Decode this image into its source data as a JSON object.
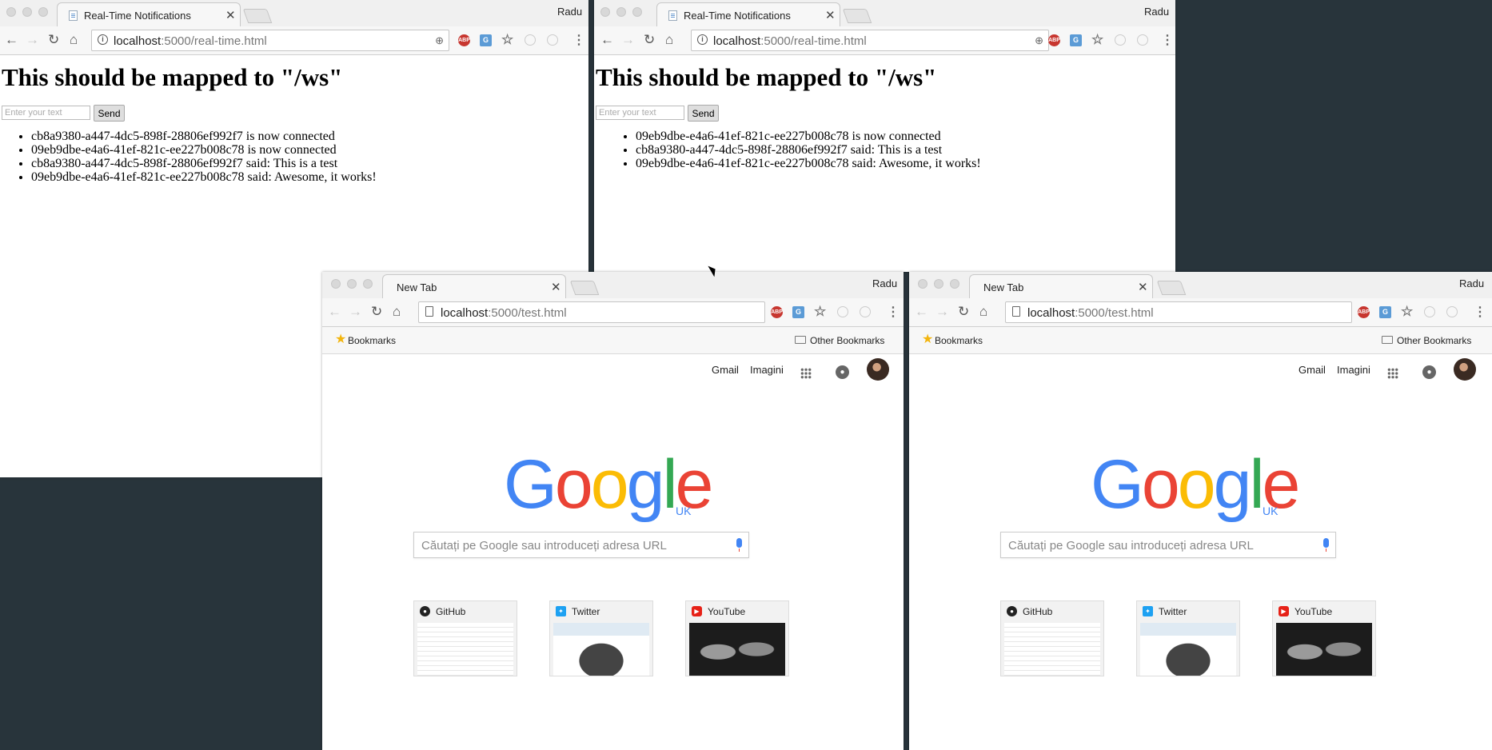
{
  "realtime": {
    "tab_title": "Real-Time Notifications",
    "profile": "Radu",
    "url_host": "localhost",
    "url_path": ":5000/real-time.html",
    "heading": "This should be mapped to \"/ws\"",
    "input_placeholder": "Enter your text",
    "send_label": "Send"
  },
  "window_left": {
    "messages": [
      "cb8a9380-a447-4dc5-898f-28806ef992f7 is now connected",
      "09eb9dbe-e4a6-41ef-821c-ee227b008c78 is now connected",
      "cb8a9380-a447-4dc5-898f-28806ef992f7 said: This is a test",
      "09eb9dbe-e4a6-41ef-821c-ee227b008c78 said: Awesome, it works!"
    ]
  },
  "window_right": {
    "messages": [
      "09eb9dbe-e4a6-41ef-821c-ee227b008c78 is now connected",
      "cb8a9380-a447-4dc5-898f-28806ef992f7 said: This is a test",
      "09eb9dbe-e4a6-41ef-821c-ee227b008c78 said: Awesome, it works!"
    ]
  },
  "newtab": {
    "tab_title": "New Tab",
    "profile": "Radu",
    "url_host": "localhost",
    "url_path": ":5000/test.html",
    "bookmarks_label": "Bookmarks",
    "other_bookmarks_label": "Other Bookmarks",
    "gmail": "Gmail",
    "images": "Imagini",
    "logo_letters": [
      "G",
      "o",
      "o",
      "g",
      "l",
      "e"
    ],
    "logo_region": "UK",
    "search_placeholder": "Căutați pe Google sau introduceți adresa URL",
    "tiles": [
      {
        "label": "GitHub",
        "icon": "github-icon"
      },
      {
        "label": "Twitter",
        "icon": "twitter-icon"
      },
      {
        "label": "YouTube",
        "icon": "youtube-icon"
      }
    ]
  },
  "icons": {
    "adblock": "ABP",
    "translate": "G"
  },
  "colors": {
    "desktop": "#28343b",
    "google_blue": "#4285f4",
    "google_red": "#ea4335",
    "google_yellow": "#fbbc05",
    "google_green": "#34a853"
  }
}
